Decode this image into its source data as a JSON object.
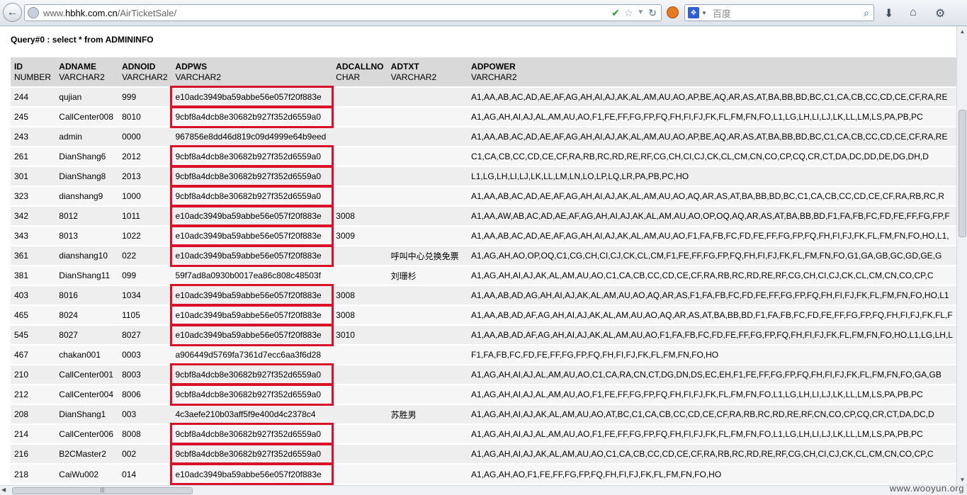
{
  "browser": {
    "url_prefix": "www.",
    "url_host": "hbhk.com.cn",
    "url_path": "/AirTicketSale/",
    "search_placeholder": "百度"
  },
  "query": "Query#0 : select * from ADMININFO",
  "columns": [
    {
      "name": "ID",
      "type": "NUMBER"
    },
    {
      "name": "ADNAME",
      "type": "VARCHAR2"
    },
    {
      "name": "ADNOID",
      "type": "VARCHAR2"
    },
    {
      "name": "ADPWS",
      "type": "VARCHAR2"
    },
    {
      "name": "ADCALLNO",
      "type": "CHAR"
    },
    {
      "name": "ADTXT",
      "type": "VARCHAR2"
    },
    {
      "name": "ADPOWER",
      "type": "VARCHAR2"
    }
  ],
  "rows": [
    {
      "id": "244",
      "name": "qujian",
      "noid": "999",
      "pws": "e10adc3949ba59abbe56e057f20f883e",
      "callno": "",
      "txt": "",
      "power": "A1,AA,AB,AC,AD,AE,AF,AG,AH,AI,AJ,AK,AL,AM,AU,AO,AP,BE,AQ,AR,AS,AT,BA,BB,BD,BC,C1,CA,CB,CC,CD,CE,CF,RA,RE",
      "highlight": true
    },
    {
      "id": "245",
      "name": "CallCenter008",
      "noid": "8010",
      "pws": "9cbf8a4dcb8e30682b927f352d6559a0",
      "callno": "",
      "txt": "",
      "power": "A1,AG,AH,AI,AJ,AL,AM,AU,AO,F1,FE,FF,FG,FP,FQ,FH,FI,FJ,FK,FL,FM,FN,FO,L1,LG,LH,LI,LJ,LK,LL,LM,LS,PA,PB,PC",
      "highlight": true
    },
    {
      "id": "243",
      "name": "admin",
      "noid": "0000",
      "pws": "967856e8dd46d819c09d4999e64b9eed",
      "callno": "",
      "txt": "",
      "power": "A1,AA,AB,AC,AD,AE,AF,AG,AH,AI,AJ,AK,AL,AM,AU,AO,AP,BE,AQ,AR,AS,AT,BA,BB,BD,BC,C1,CA,CB,CC,CD,CE,CF,RA,RE",
      "highlight": false
    },
    {
      "id": "261",
      "name": "DianShang6",
      "noid": "2012",
      "pws": "9cbf8a4dcb8e30682b927f352d6559a0",
      "callno": "",
      "txt": "",
      "power": "C1,CA,CB,CC,CD,CE,CF,RA,RB,RC,RD,RE,RF,CG,CH,CI,CJ,CK,CL,CM,CN,CO,CP,CQ,CR,CT,DA,DC,DD,DE,DG,DH,D",
      "highlight": true
    },
    {
      "id": "301",
      "name": "DianShang8",
      "noid": "2013",
      "pws": "9cbf8a4dcb8e30682b927f352d6559a0",
      "callno": "",
      "txt": "",
      "power": "L1,LG,LH,LI,LJ,LK,LL,LM,LN,LO,LP,LQ,LR,PA,PB,PC,HO",
      "highlight": true
    },
    {
      "id": "323",
      "name": "dianshang9",
      "noid": "1000",
      "pws": "9cbf8a4dcb8e30682b927f352d6559a0",
      "callno": "",
      "txt": "",
      "power": "A1,AA,AB,AC,AD,AE,AF,AG,AH,AI,AJ,AK,AL,AM,AU,AO,AQ,AR,AS,AT,BA,BB,BD,BC,C1,CA,CB,CC,CD,CE,CF,RA,RB,RC,R",
      "highlight": true
    },
    {
      "id": "342",
      "name": "8012",
      "noid": "1011",
      "pws": "e10adc3949ba59abbe56e057f20f883e",
      "callno": "3008",
      "txt": "",
      "power": "A1,AA,AW,AB,AC,AD,AE,AF,AG,AH,AI,AJ,AK,AL,AM,AU,AO,OP,OQ,AQ,AR,AS,AT,BA,BB,BD,F1,FA,FB,FC,FD,FE,FF,FG,FP,F",
      "highlight": true
    },
    {
      "id": "343",
      "name": "8013",
      "noid": "1022",
      "pws": "e10adc3949ba59abbe56e057f20f883e",
      "callno": "3009",
      "txt": "",
      "power": "A1,AA,AB,AC,AD,AE,AF,AG,AH,AI,AJ,AK,AL,AM,AU,AO,F1,FA,FB,FC,FD,FE,FF,FG,FP,FQ,FH,FI,FJ,FK,FL,FM,FN,FO,HO,L1,",
      "highlight": true
    },
    {
      "id": "361",
      "name": "dianshang10",
      "noid": "022",
      "pws": "e10adc3949ba59abbe56e057f20f883e",
      "callno": "",
      "txt": "呼叫中心兑换免票",
      "power": "A1,AG,AH,AO,OP,OQ,C1,CG,CH,CI,CJ,CK,CL,CM,F1,FE,FF,FG,FP,FQ,FH,FI,FJ,FK,FL,FM,FN,FO,G1,GA,GB,GC,GD,GE,G",
      "highlight": true
    },
    {
      "id": "381",
      "name": "DianShang11",
      "noid": "099",
      "pws": "59f7ad8a0930b0017ea86c808c48503f",
      "callno": "",
      "txt": "刘珊杉",
      "power": "A1,AG,AH,AI,AJ,AK,AL,AM,AU,AO,C1,CA,CB,CC,CD,CE,CF,RA,RB,RC,RD,RE,RF,CG,CH,CI,CJ,CK,CL,CM,CN,CO,CP,C",
      "highlight": false
    },
    {
      "id": "403",
      "name": "8016",
      "noid": "1034",
      "pws": "e10adc3949ba59abbe56e057f20f883e",
      "callno": "3008",
      "txt": "",
      "power": "A1,AA,AB,AD,AG,AH,AI,AJ,AK,AL,AM,AU,AO,AQ,AR,AS,F1,FA,FB,FC,FD,FE,FF,FG,FP,FQ,FH,FI,FJ,FK,FL,FM,FN,FO,HO,L1",
      "highlight": true
    },
    {
      "id": "465",
      "name": "8024",
      "noid": "1105",
      "pws": "e10adc3949ba59abbe56e057f20f883e",
      "callno": "3008",
      "txt": "",
      "power": "A1,AA,AB,AD,AF,AG,AH,AI,AJ,AK,AL,AM,AU,AO,AQ,AR,AS,AT,BA,BB,BD,F1,FA,FB,FC,FD,FE,FF,FG,FP,FQ,FH,FI,FJ,FK,FL,F",
      "highlight": true
    },
    {
      "id": "545",
      "name": "8027",
      "noid": "8027",
      "pws": "e10adc3949ba59abbe56e057f20f883e",
      "callno": "3010",
      "txt": "",
      "power": "A1,AA,AB,AD,AF,AG,AH,AI,AJ,AK,AL,AM,AU,AO,F1,FA,FB,FC,FD,FE,FF,FG,FP,FQ,FH,FI,FJ,FK,FL,FM,FN,FO,HO,L1,LG,LH,L",
      "highlight": true
    },
    {
      "id": "467",
      "name": "chakan001",
      "noid": "0003",
      "pws": "a906449d5769fa7361d7ecc6aa3f6d28",
      "callno": "",
      "txt": "",
      "power": "F1,FA,FB,FC,FD,FE,FF,FG,FP,FQ,FH,FI,FJ,FK,FL,FM,FN,FO,HO",
      "highlight": false
    },
    {
      "id": "210",
      "name": "CallCenter001",
      "noid": "8003",
      "pws": "9cbf8a4dcb8e30682b927f352d6559a0",
      "callno": "",
      "txt": "",
      "power": "A1,AG,AH,AI,AJ,AL,AM,AU,AO,C1,CA,RA,CN,CT,DG,DN,DS,EC,EH,F1,FE,FF,FG,FP,FQ,FH,FI,FJ,FK,FL,FM,FN,FO,GA,GB",
      "highlight": true
    },
    {
      "id": "212",
      "name": "CallCenter004",
      "noid": "8006",
      "pws": "9cbf8a4dcb8e30682b927f352d6559a0",
      "callno": "",
      "txt": "",
      "power": "A1,AG,AH,AI,AJ,AL,AM,AU,AO,F1,FE,FF,FG,FP,FQ,FH,FI,FJ,FK,FL,FM,FN,FO,L1,LG,LH,LI,LJ,LK,LL,LM,LS,PA,PB,PC",
      "highlight": true
    },
    {
      "id": "208",
      "name": "DianShang1",
      "noid": "003",
      "pws": "4c3aefe210b03aff5f9e400d4c2378c4",
      "callno": "",
      "txt": "苏胜男",
      "power": "A1,AG,AH,AI,AJ,AK,AL,AM,AU,AO,AT,BC,C1,CA,CB,CC,CD,CE,CF,RA,RB,RC,RD,RE,RF,CN,CO,CP,CQ,CR,CT,DA,DC,D",
      "highlight": false
    },
    {
      "id": "214",
      "name": "CallCenter006",
      "noid": "8008",
      "pws": "9cbf8a4dcb8e30682b927f352d6559a0",
      "callno": "",
      "txt": "",
      "power": "A1,AG,AH,AI,AJ,AL,AM,AU,AO,F1,FE,FF,FG,FP,FQ,FH,FI,FJ,FK,FL,FM,FN,FO,L1,LG,LH,LI,LJ,LK,LL,LM,LS,PA,PB,PC",
      "highlight": true
    },
    {
      "id": "216",
      "name": "B2CMaster2",
      "noid": "002",
      "pws": "9cbf8a4dcb8e30682b927f352d6559a0",
      "callno": "",
      "txt": "",
      "power": "A1,AG,AH,AI,AJ,AK,AL,AM,AU,AO,C1,CA,CB,CC,CD,CE,CF,RA,RB,RC,RD,RE,RF,CG,CH,CI,CJ,CK,CL,CM,CN,CO,CP,C",
      "highlight": true
    },
    {
      "id": "218",
      "name": "CaiWu002",
      "noid": "014",
      "pws": "e10adc3949ba59abbe56e057f20f883e",
      "callno": "",
      "txt": "",
      "power": "A1,AG,AH,AO,F1,FE,FF,FG,FP,FQ,FH,FI,FJ,FK,FL,FM,FN,FO,HO",
      "highlight": true
    }
  ],
  "watermark": "www.wooyun.org",
  "colors": {
    "highlight_border": "#d9112b",
    "header_bg": "#d9d9d9"
  }
}
